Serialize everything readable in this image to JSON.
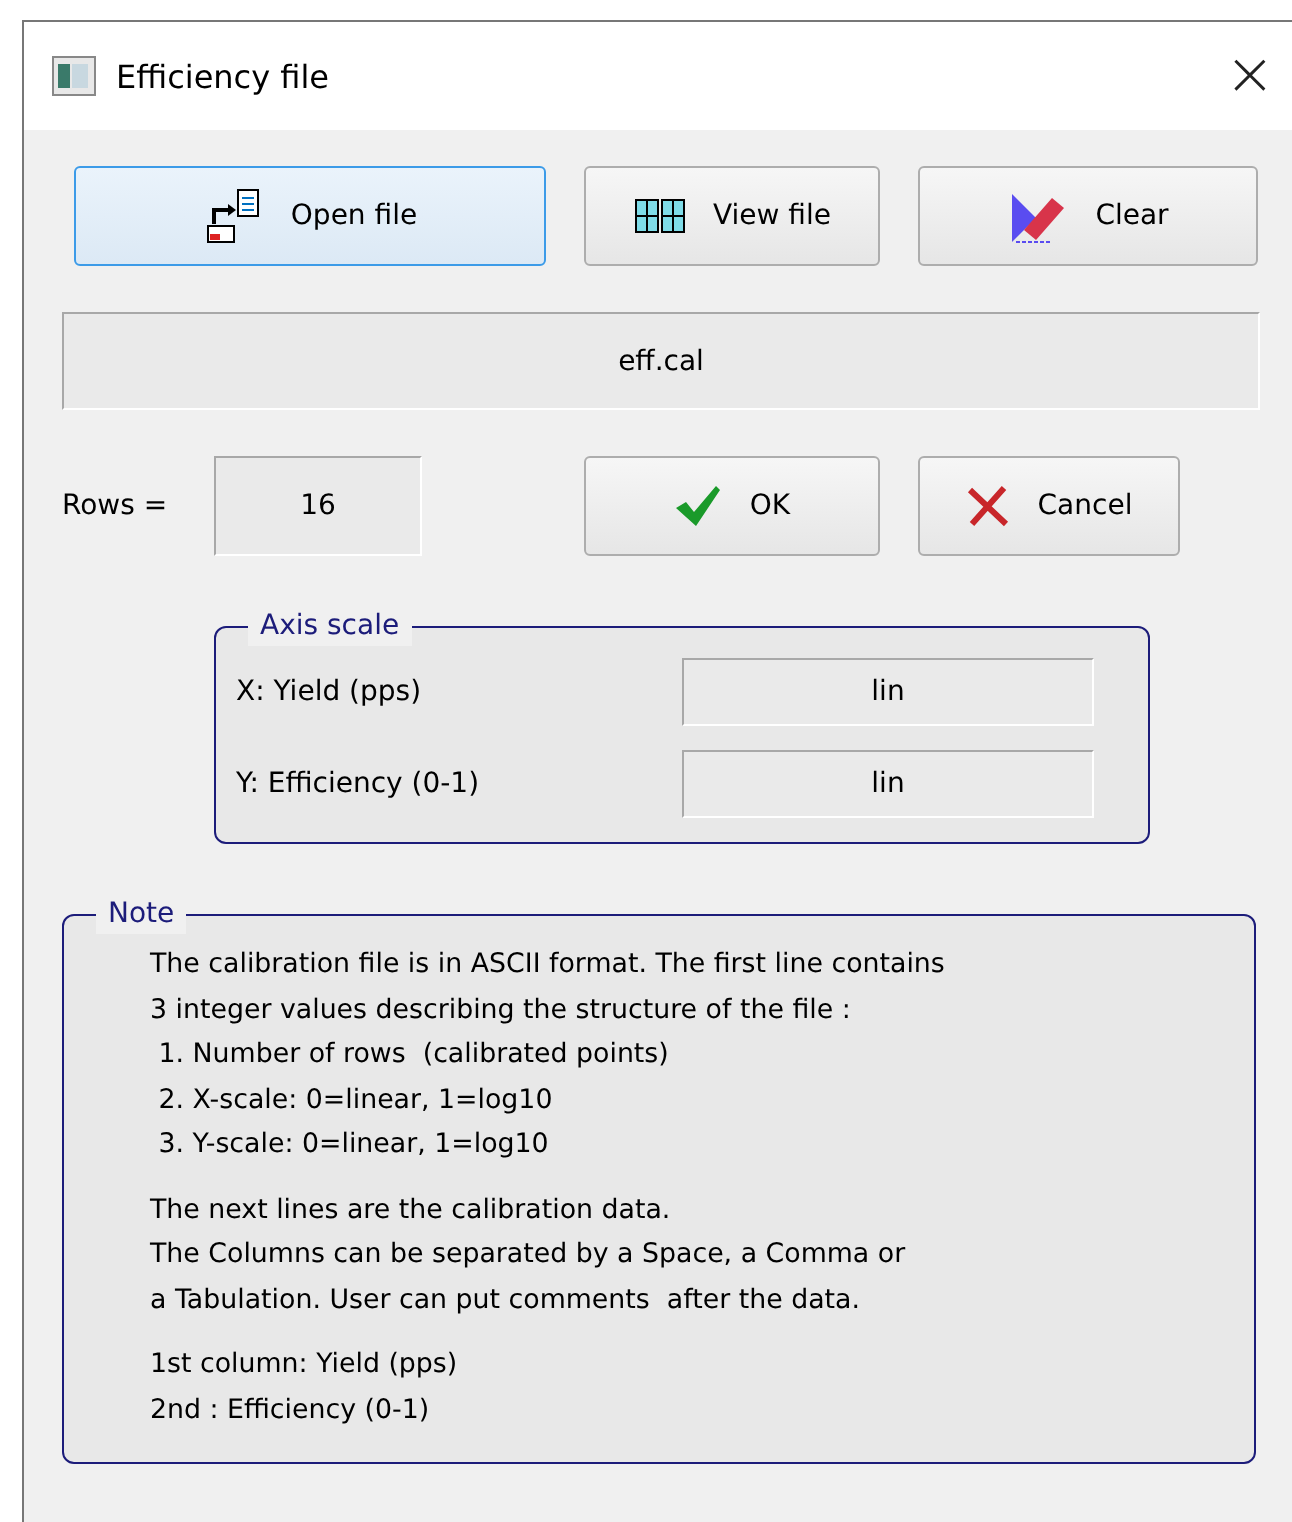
{
  "window": {
    "title": "Efficiency file",
    "close": "×"
  },
  "toolbar": [
    {
      "kind": "open",
      "label": "Open file",
      "focused": true
    },
    {
      "kind": "view",
      "label": "View file",
      "focused": false
    },
    {
      "kind": "clear",
      "label": "Clear",
      "focused": false
    }
  ],
  "file_name": "eff.cal",
  "rows": {
    "label": "Rows =",
    "value": "16"
  },
  "actions": [
    {
      "kind": "ok",
      "label": "OK"
    },
    {
      "kind": "cancel",
      "label": "Cancel"
    }
  ],
  "axis_scale": {
    "title": "Axis scale",
    "rows": [
      {
        "label": "X: Yield (pps)",
        "value": "lin"
      },
      {
        "label": "Y: Efficiency (0-1)",
        "value": "lin"
      }
    ]
  },
  "note": {
    "title": "Note",
    "paragraphs": [
      [
        "The calibration file is in ASCII format. The first line contains",
        "3 integer values describing the structure of the file :",
        " 1. Number of rows  (calibrated points)",
        " 2. X-scale: 0=linear, 1=log10",
        " 3. Y-scale: 0=linear, 1=log10"
      ],
      [
        "The next lines are the calibration data.",
        "The Columns can be separated by a Space, a Comma or",
        "a Tabulation. User can put comments  after the data."
      ],
      [
        "1st column: Yield (pps)",
        "2nd : Efficiency (0-1)"
      ]
    ]
  }
}
